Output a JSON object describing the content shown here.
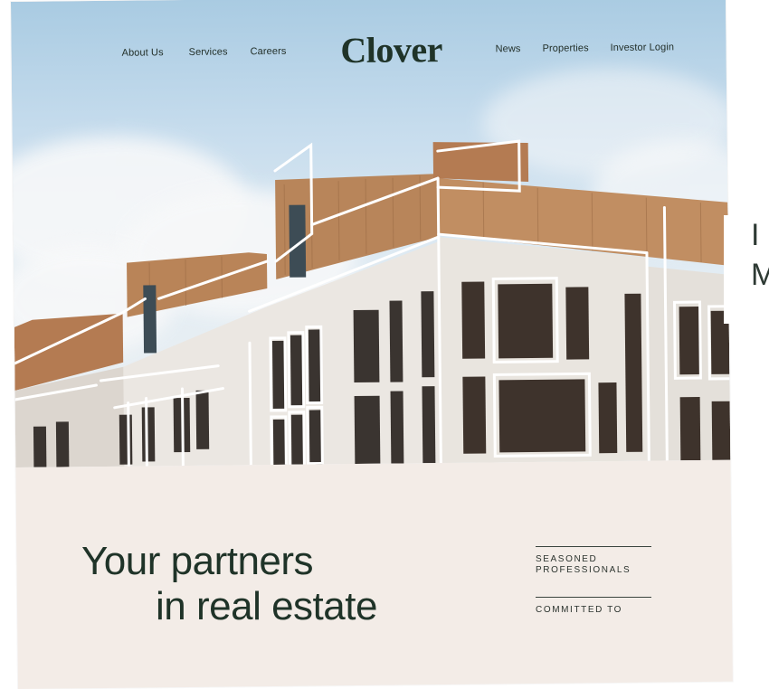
{
  "nav": {
    "left": [
      "About Us",
      "Services",
      "Careers"
    ],
    "right": [
      "News",
      "Properties",
      "Investor Login"
    ],
    "logo": "Clover"
  },
  "hero": {
    "headline_line1": "Your partners",
    "headline_line2": "in real estate"
  },
  "features": [
    "SEASONED PROFESSIONALS",
    "COMMITTED TO"
  ],
  "peek_text": [
    "I",
    "M"
  ],
  "colors": {
    "brand_green": "#1f3328",
    "paper": "#f3ece7",
    "sky": "#b7d3e8",
    "timber": "#b8855a",
    "facade": "#ebe7e2"
  }
}
